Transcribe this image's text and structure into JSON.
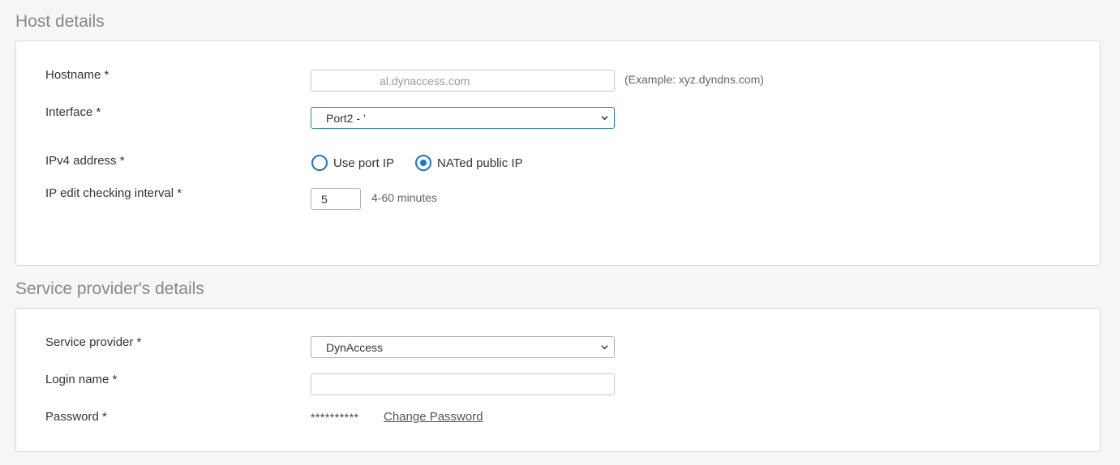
{
  "host_section": {
    "title": "Host details",
    "hostname": {
      "label": "Hostname *",
      "value": "al.dynaccess.com",
      "hint": "(Example: xyz.dyndns.com)"
    },
    "interface": {
      "label": "Interface *",
      "selected": "Port2 - ’"
    },
    "ipv4": {
      "label": "IPv4 address *",
      "options": [
        "Use port IP",
        "NATed public IP"
      ],
      "selected": "NATed public IP"
    },
    "interval": {
      "label": "IP edit checking interval *",
      "value": "5",
      "hint": "4-60 minutes"
    }
  },
  "provider_section": {
    "title": "Service provider's details",
    "service_provider": {
      "label": "Service provider *",
      "selected": "DynAccess"
    },
    "login_name": {
      "label": "Login name *",
      "value": ""
    },
    "password": {
      "label": "Password *",
      "masked_value": "**********",
      "change_link": "Change Password"
    }
  },
  "colors": {
    "accent": "#1a78c2",
    "focus_border": "#2d7da8",
    "page_bg": "#f6f6f6"
  }
}
